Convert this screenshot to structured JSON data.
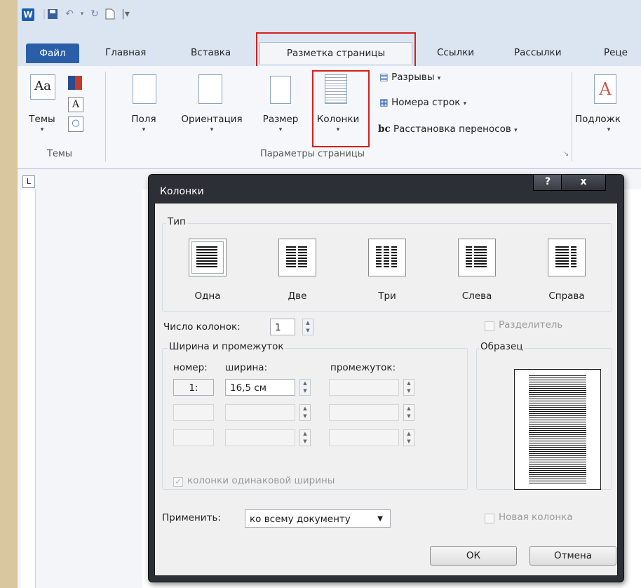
{
  "qat": {
    "logo": "W"
  },
  "tabs": [
    {
      "label": "Файл"
    },
    {
      "label": "Главная"
    },
    {
      "label": "Вставка"
    },
    {
      "label": "Разметка страницы"
    },
    {
      "label": "Ссылки"
    },
    {
      "label": "Рассылки"
    },
    {
      "label": "Реце"
    }
  ],
  "ribbon": {
    "themes_btn": "Темы",
    "themes_group": "Темы",
    "margins": "Поля",
    "orientation": "Ориентация",
    "size": "Размер",
    "columns": "Колонки",
    "breaks": "Разрывы",
    "line_numbers": "Номера строк",
    "hyphenation": "Расстановка переносов",
    "page_setup_group": "Параметры страницы",
    "watermark": "Подложк"
  },
  "dialog": {
    "title": "Колонки",
    "help": "?",
    "close": "x",
    "type_group": "Тип",
    "presets": [
      "Одна",
      "Две",
      "Три",
      "Слева",
      "Справа"
    ],
    "num_columns_label": "Число колонок:",
    "num_columns_value": "1",
    "separator_label": "Разделитель",
    "width_group": "Ширина и промежуток",
    "col_number_header": "номер:",
    "col_width_header": "ширина:",
    "col_spacing_header": "промежуток:",
    "row1_number": "1:",
    "row1_width": "16,5 см",
    "equal_width_label": "колонки одинаковой ширины",
    "preview_group": "Образец",
    "apply_label": "Применить:",
    "apply_value": "ко всему документу",
    "new_column_label": "Новая колонка",
    "ok": "ОК",
    "cancel": "Отмена"
  },
  "colors": {
    "highlight": "#d4201c",
    "file_tab": "#2a5fa8"
  }
}
